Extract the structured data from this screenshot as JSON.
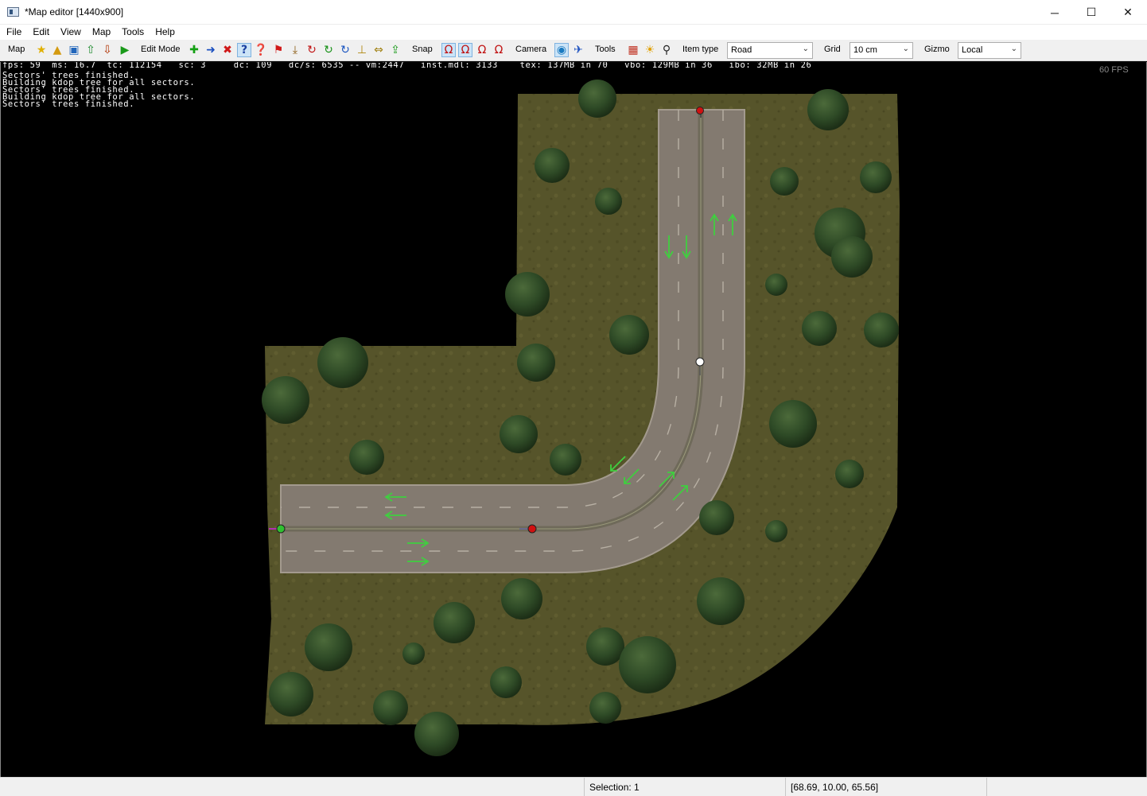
{
  "window": {
    "title": "*Map editor [1440x900]",
    "controls": {
      "minimize": "─",
      "maximize": "☐",
      "close": "✕"
    }
  },
  "menu": [
    "File",
    "Edit",
    "View",
    "Map",
    "Tools",
    "Help"
  ],
  "toolbar": {
    "map_label": "Map",
    "edit_mode_label": "Edit Mode",
    "snap_label": "Snap",
    "camera_label": "Camera",
    "tools_label": "Tools",
    "item_type_label": "Item type",
    "item_type_value": "Road",
    "grid_label": "Grid",
    "grid_value": "10 cm",
    "gizmo_label": "Gizmo",
    "gizmo_value": "Local"
  },
  "viewport": {
    "stats": "fps: 59  ms: 16.7  tc: 112154   sc: 3     dc: 109   dc/s: 6535 -- vm:2447   inst.mdl: 3133    tex: 137MB in 70   vbo: 129MB in 36   ibo: 32MB in 26",
    "fps_overlay": "60 FPS",
    "log": [
      "Sectors' trees finished.",
      "Building kdop tree for all sectors.",
      "Sectors' trees finished.",
      "Building kdop tree for all sectors.",
      "Sectors' trees finished."
    ],
    "colors": {
      "grass": "#57552a",
      "road": "#837a70",
      "lane_arrow": "#3fcf3f",
      "node_red": "#d01010",
      "node_green": "#30c030",
      "node_white": "#ffffff"
    }
  },
  "statusbar": {
    "selection": "Selection: 1",
    "coordinates": "[68.69, 10.00, 65.56]"
  }
}
